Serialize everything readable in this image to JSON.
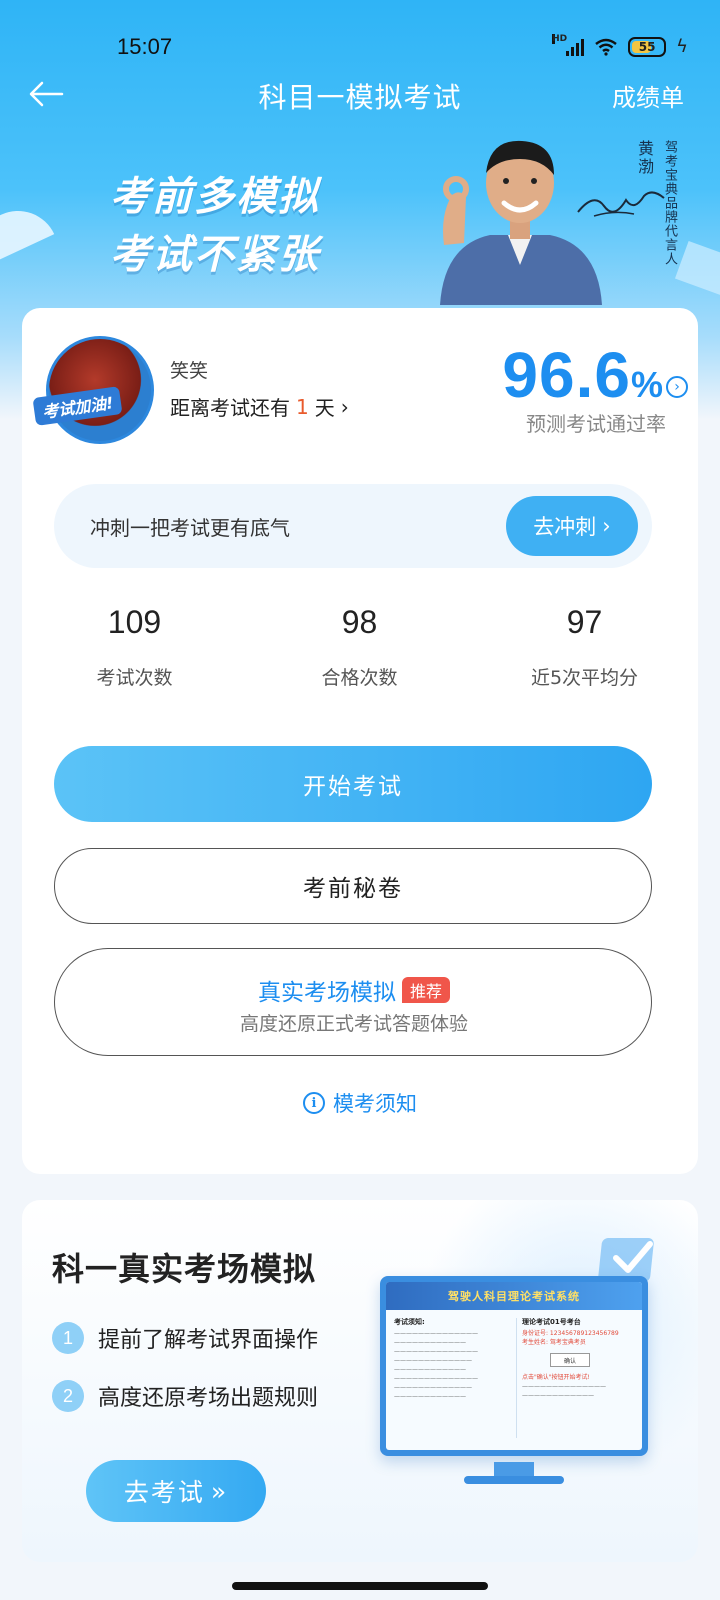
{
  "status_bar": {
    "time": "15:07",
    "battery": "55",
    "network": "HD"
  },
  "nav": {
    "title": "科目一模拟考试",
    "right_link": "成绩单"
  },
  "banner": {
    "slogan_line1": "考前多模拟",
    "slogan_line2": "考试不紧张",
    "spokesperson_name": "黄渤",
    "spokesperson_role": "驾考宝典品牌代言人"
  },
  "profile": {
    "avatar_label": "考试加油!",
    "username": "笑笑",
    "countdown_prefix": "距离考试还有",
    "countdown_days": "1",
    "countdown_suffix": "天",
    "pass_rate_value": "96.6",
    "pass_rate_unit": "%",
    "pass_rate_label": "预测考试通过率"
  },
  "sprint": {
    "text": "冲刺一把考试更有底气",
    "button": "去冲刺"
  },
  "stats": [
    {
      "value": "109",
      "label": "考试次数"
    },
    {
      "value": "98",
      "label": "合格次数"
    },
    {
      "value": "97",
      "label": "近5次平均分"
    }
  ],
  "buttons": {
    "start": "开始考试",
    "secret": "考前秘卷",
    "real_title": "真实考场模拟",
    "real_badge": "推荐",
    "real_sub": "高度还原正式考试答题体验",
    "notice": "模考须知"
  },
  "promo": {
    "title": "科一真实考场模拟",
    "features": [
      {
        "num": "1",
        "text": "提前了解考试界面操作"
      },
      {
        "num": "2",
        "text": "高度还原考场出题规则"
      }
    ],
    "button": "去考试",
    "screen": {
      "header": "驾驶人科目理论考试系统",
      "left_title": "考试须知:",
      "right_title": "理论考试01号考台",
      "right_line1": "身份证号: 123456789123456789",
      "right_line2": "考生姓名: 驾考宝典考员",
      "confirm": "确认",
      "right_line3": "点击\"确认\"按钮开始考试!"
    }
  }
}
